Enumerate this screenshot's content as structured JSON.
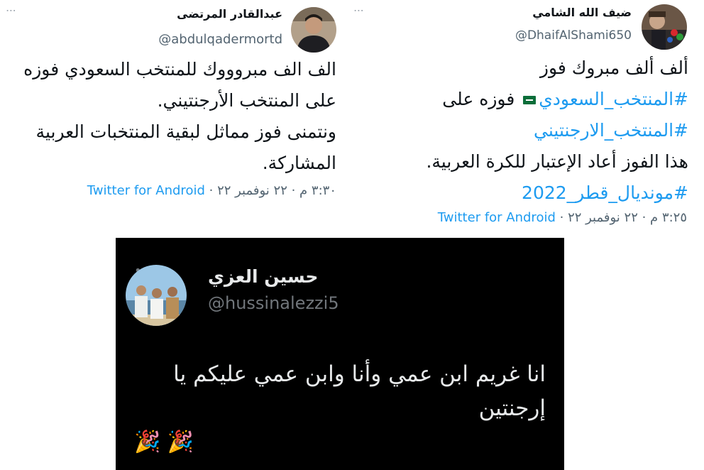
{
  "tweetA": {
    "name": "ضيف الله الشامي",
    "handle": "@DhaifAlShami650",
    "line1": "ألف ألف مبروك فوز",
    "hashtag_saudi": "#المنتخب_السعودي",
    "flag_icon": "saudi-flag-icon",
    "fawzah_ala": "فوزه على",
    "hashtag_argentina": "#المنتخب_الارجنتيني",
    "line4": "هذا الفوز أعاد الإعتبار للكرة العربية.",
    "hashtag_mondial": "#مونديال_قطر_2022",
    "meta_time": "٣:٢٥ م · ٢٢ نوفمبر ٢٢ · ",
    "meta_app": "Twitter for Android"
  },
  "tweetB": {
    "name": "عبدالقادر المرتضى",
    "handle": "@abdulqadermortd",
    "line1": "الف الف مبروووك للمنتخب السعودي فوزه على المنتخب الأرجنتيني.",
    "line2": "ونتمنى فوز مماثل لبقية المنتخبات العربية المشاركة.",
    "meta_time": "٣:٣٠ م · ٢٢ نوفمبر ٢٢ · ",
    "meta_app": "Twitter for Android"
  },
  "tweetC": {
    "name": "حسين العزي",
    "handle": "@hussinalezzi5",
    "text": "انا غريم ابن عمي وأنا وابن عمي عليكم يا إرجنتين",
    "emoji": "🎉 🎉"
  },
  "icons": {
    "more": "more-options-icon",
    "party": "party-popper-icon"
  }
}
